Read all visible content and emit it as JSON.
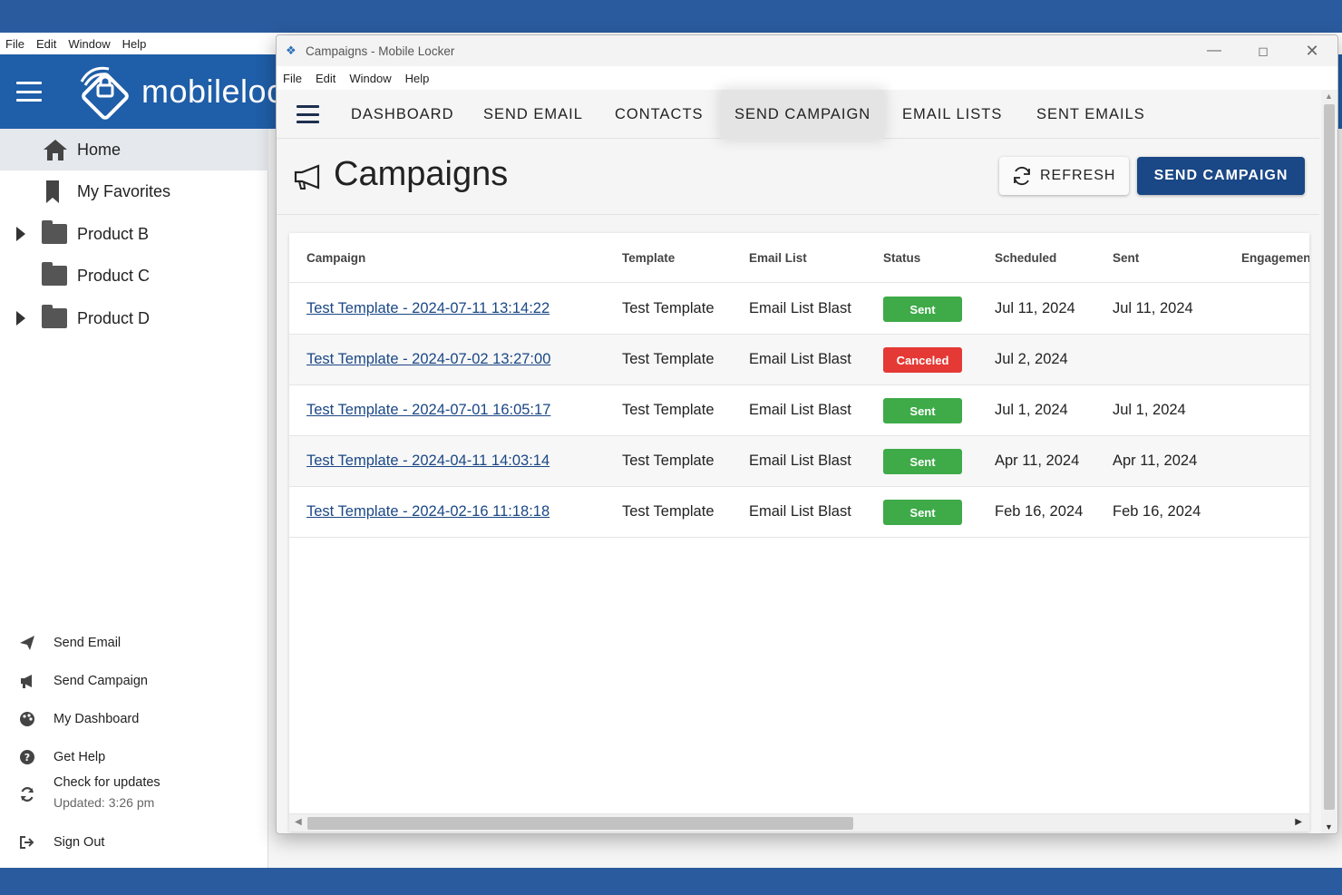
{
  "outer": {
    "menu": [
      "File",
      "Edit",
      "Window",
      "Help"
    ],
    "logo_text": "mobilelocker",
    "tree": [
      {
        "label": "Home",
        "icon": "home-icon",
        "active": true,
        "expandable": false
      },
      {
        "label": "My Favorites",
        "icon": "bookmark-icon",
        "active": false,
        "expandable": false
      },
      {
        "label": "Product B",
        "icon": "folder-icon",
        "active": false,
        "expandable": true
      },
      {
        "label": "Product C",
        "icon": "folder-icon",
        "active": false,
        "expandable": false
      },
      {
        "label": "Product D",
        "icon": "folder-icon",
        "active": false,
        "expandable": true
      }
    ],
    "actions": [
      {
        "label": "Send Email",
        "icon": "paper-plane-icon"
      },
      {
        "label": "Send Campaign",
        "icon": "megaphone-icon"
      },
      {
        "label": "My Dashboard",
        "icon": "palette-icon"
      },
      {
        "label": "Get Help",
        "icon": "help-circle-icon"
      },
      {
        "label": "Check for updates",
        "sub": "Updated: 3:26 pm",
        "icon": "refresh-icon"
      },
      {
        "label": "Sign Out",
        "icon": "sign-out-icon"
      }
    ]
  },
  "window": {
    "title": "Campaigns - Mobile Locker",
    "menu": [
      "File",
      "Edit",
      "Window",
      "Help"
    ],
    "nav_tabs": [
      "DASHBOARD",
      "SEND EMAIL",
      "CONTACTS",
      "SEND CAMPAIGN",
      "EMAIL LISTS",
      "SENT EMAILS"
    ],
    "active_tab": "SEND CAMPAIGN",
    "page_title": "Campaigns",
    "refresh_label": "REFRESH",
    "send_campaign_label": "SEND CAMPAIGN",
    "table": {
      "columns": [
        "Campaign",
        "Template",
        "Email List",
        "Status",
        "Scheduled",
        "Sent",
        "Engagement"
      ],
      "rows": [
        {
          "campaign": "Test Template - 2024-07-11 13:14:22",
          "template": "Test Template",
          "email_list": "Email List Blast",
          "status": "Sent",
          "scheduled": "Jul 11, 2024",
          "sent": "Jul 11, 2024"
        },
        {
          "campaign": "Test Template - 2024-07-02 13:27:00",
          "template": "Test Template",
          "email_list": "Email List Blast",
          "status": "Canceled",
          "scheduled": "Jul 2, 2024",
          "sent": ""
        },
        {
          "campaign": "Test Template - 2024-07-01 16:05:17",
          "template": "Test Template",
          "email_list": "Email List Blast",
          "status": "Sent",
          "scheduled": "Jul 1, 2024",
          "sent": "Jul 1, 2024"
        },
        {
          "campaign": "Test Template - 2024-04-11 14:03:14",
          "template": "Test Template",
          "email_list": "Email List Blast",
          "status": "Sent",
          "scheduled": "Apr 11, 2024",
          "sent": "Apr 11, 2024"
        },
        {
          "campaign": "Test Template - 2024-02-16 11:18:18",
          "template": "Test Template",
          "email_list": "Email List Blast",
          "status": "Sent",
          "scheduled": "Feb 16, 2024",
          "sent": "Feb 16, 2024"
        }
      ]
    }
  },
  "colors": {
    "brand_blue": "#1f5ea8",
    "button_blue": "#1a4785",
    "sent_green": "#3eaa48",
    "canceled_red": "#e53935",
    "desktop_blue": "#2b5b9f"
  }
}
